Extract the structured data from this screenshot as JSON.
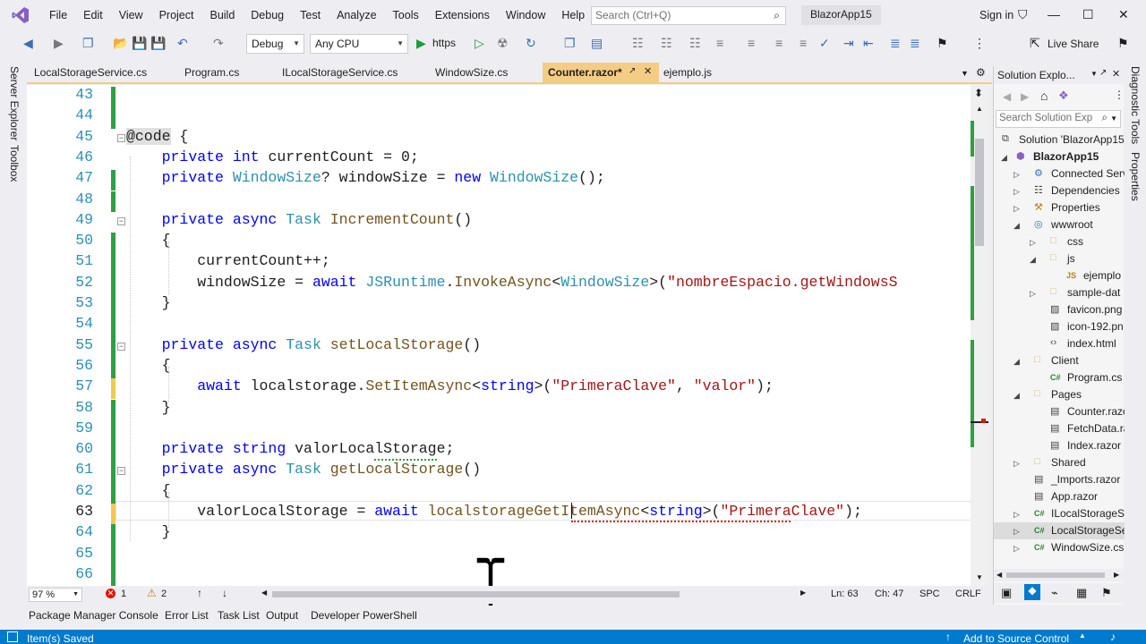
{
  "menu": {
    "items": [
      "File",
      "Edit",
      "View",
      "Project",
      "Build",
      "Debug",
      "Test",
      "Analyze",
      "Tools",
      "Extensions",
      "Window",
      "Help"
    ],
    "search_placeholder": "Search (Ctrl+Q)",
    "solution_name": "BlazorApp15",
    "sign_in": "Sign in"
  },
  "toolbar": {
    "config": "Debug",
    "platform": "Any CPU",
    "run_target": "https",
    "live_share": "Live Share"
  },
  "left_strip": {
    "server_explorer": "Server Explorer",
    "toolbox": "Toolbox"
  },
  "right_strip": {
    "diagnostic_tools": "Diagnostic Tools",
    "properties": "Properties"
  },
  "tabs": [
    "LocalStorageService.cs",
    "Program.cs",
    "ILocalStorageService.cs",
    "WindowSize.cs",
    "Counter.razor*",
    "ejemplo.js"
  ],
  "active_tab": "Counter.razor*",
  "editor": {
    "lines": [
      {
        "n": "43",
        "t": ""
      },
      {
        "n": "44",
        "t": ""
      },
      {
        "n": "45",
        "t": "@code {"
      },
      {
        "n": "46",
        "t": "    private int currentCount = 0;"
      },
      {
        "n": "47",
        "t": "    private WindowSize? windowSize = new WindowSize();"
      },
      {
        "n": "48",
        "t": ""
      },
      {
        "n": "49",
        "t": "    private async Task IncrementCount()"
      },
      {
        "n": "50",
        "t": "    {"
      },
      {
        "n": "51",
        "t": "        currentCount++;"
      },
      {
        "n": "52",
        "t": "        windowSize = await JSRuntime.InvokeAsync<WindowSize>(\"nombreEspacio.getWindowsS"
      },
      {
        "n": "53",
        "t": "    }"
      },
      {
        "n": "54",
        "t": ""
      },
      {
        "n": "55",
        "t": "    private async Task setLocalStorage()"
      },
      {
        "n": "56",
        "t": "    {"
      },
      {
        "n": "57",
        "t": "        await localstorage.SetItemAsync<string>(\"PrimeraClave\", \"valor\");"
      },
      {
        "n": "58",
        "t": "    }"
      },
      {
        "n": "59",
        "t": ""
      },
      {
        "n": "60",
        "t": "    private string valorLocalStorage;"
      },
      {
        "n": "61",
        "t": "    private async Task getLocalStorage()"
      },
      {
        "n": "62",
        "t": "    {"
      },
      {
        "n": "63",
        "t": "        valorLocalStorage = await localstorageGetItemAsync<string>(\"PrimeraClave\");"
      },
      {
        "n": "64",
        "t": "    }"
      },
      {
        "n": "65",
        "t": ""
      },
      {
        "n": "66",
        "t": ""
      }
    ],
    "current_line": "63"
  },
  "editor_status": {
    "zoom": "97 %",
    "errors": "1",
    "warnings": "2",
    "ln": "Ln: 63",
    "ch": "Ch: 47",
    "spc": "SPC",
    "crlf": "CRLF"
  },
  "bottom_tabs": [
    "Package Manager Console",
    "Error List",
    "Task List",
    "Output",
    "Developer PowerShell"
  ],
  "status": {
    "left": "Item(s) Saved",
    "right": "Add to Source Control"
  },
  "solution_explorer": {
    "title": "Solution Explo...",
    "search_placeholder": "Search Solution Exp",
    "items": [
      {
        "label": "Solution 'BlazorApp15",
        "bold": false
      },
      {
        "label": "BlazorApp15",
        "bold": true
      },
      {
        "label": "Connected Serv",
        "bold": false
      },
      {
        "label": "Dependencies",
        "bold": false
      },
      {
        "label": "Properties",
        "bold": false
      },
      {
        "label": "wwwroot",
        "bold": false
      },
      {
        "label": "css",
        "bold": false
      },
      {
        "label": "js",
        "bold": false
      },
      {
        "label": "ejemplo",
        "bold": false
      },
      {
        "label": "sample-dat",
        "bold": false
      },
      {
        "label": "favicon.png",
        "bold": false
      },
      {
        "label": "icon-192.pn",
        "bold": false
      },
      {
        "label": "index.html",
        "bold": false
      },
      {
        "label": "Client",
        "bold": false
      },
      {
        "label": "Program.cs",
        "bold": false
      },
      {
        "label": "Pages",
        "bold": false
      },
      {
        "label": "Counter.razo",
        "bold": false
      },
      {
        "label": "FetchData.ra",
        "bold": false
      },
      {
        "label": "Index.razor",
        "bold": false
      },
      {
        "label": "Shared",
        "bold": false
      },
      {
        "label": "_Imports.razor",
        "bold": false
      },
      {
        "label": "App.razor",
        "bold": false
      },
      {
        "label": "ILocalStorageSe",
        "bold": false
      },
      {
        "label": "LocalStorageSe",
        "bold": false
      },
      {
        "label": "WindowSize.cs",
        "bold": false
      }
    ]
  }
}
